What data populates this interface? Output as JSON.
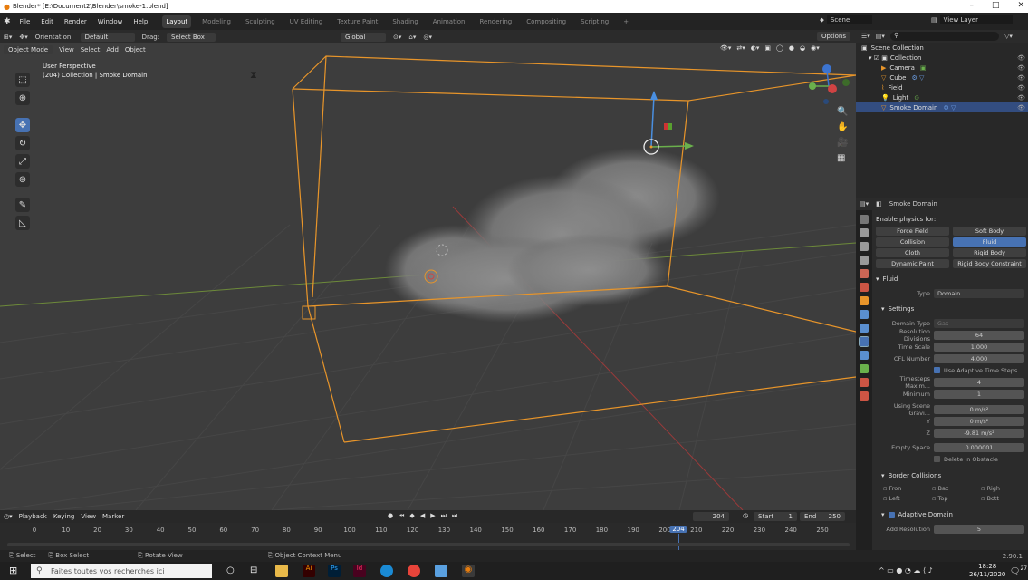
{
  "window": {
    "title": "Blender* [E:\\Document2\\Blender\\smoke-1.blend]"
  },
  "menu": {
    "items": [
      "File",
      "Edit",
      "Render",
      "Window",
      "Help"
    ],
    "workspaces": [
      "Layout",
      "Modeling",
      "Sculpting",
      "UV Editing",
      "Texture Paint",
      "Shading",
      "Animation",
      "Rendering",
      "Compositing",
      "Scripting",
      "+"
    ],
    "scene": "Scene",
    "view_layer": "View Layer"
  },
  "header": {
    "orientation_label": "Orientation:",
    "orientation_value": "Default",
    "drag_label": "Drag:",
    "drag_value": "Select Box",
    "transform": "Global",
    "options": "Options"
  },
  "viewport": {
    "mode": "Object Mode",
    "menu": [
      "View",
      "Select",
      "Add",
      "Object"
    ],
    "perspective": "User Perspective",
    "collection_info": "(204) Collection | Smoke Domain"
  },
  "timeline": {
    "menu": [
      "Playback",
      "Keying",
      "View",
      "Marker"
    ],
    "current_frame": "204",
    "start_label": "Start",
    "start": "1",
    "end_label": "End",
    "end": "250",
    "ticks": [
      "0",
      "10",
      "20",
      "30",
      "40",
      "50",
      "60",
      "70",
      "80",
      "90",
      "100",
      "110",
      "120",
      "130",
      "140",
      "150",
      "160",
      "170",
      "180",
      "190",
      "200",
      "210",
      "220",
      "230",
      "240",
      "250"
    ]
  },
  "statusbar": {
    "select": "Select",
    "box_select": "Box Select",
    "rotate": "Rotate View",
    "context": "Object Context Menu",
    "version": "2.90.1"
  },
  "taskbar": {
    "search_placeholder": "Faites toutes vos recherches ici",
    "time": "18:28",
    "date": "26/11/2020",
    "notif": "27"
  },
  "outliner": {
    "root": "Scene Collection",
    "collection": "Collection",
    "items": [
      "Camera",
      "Cube",
      "Field",
      "Light",
      "Smoke Domain"
    ]
  },
  "properties": {
    "object_name": "Smoke Domain",
    "enable_physics": "Enable physics for:",
    "physics_buttons": [
      "Force Field",
      "Soft Body",
      "Collision",
      "Fluid",
      "Cloth",
      "Rigid Body",
      "Dynamic Paint",
      "Rigid Body Constraint"
    ],
    "fluid_panel": "Fluid",
    "type_label": "Type",
    "type_value": "Domain",
    "settings_panel": "Settings",
    "fields": [
      {
        "label": "Domain Type",
        "value": "Gas"
      },
      {
        "label": "Resolution Divisions",
        "value": "64"
      },
      {
        "label": "Time Scale",
        "value": "1.000"
      },
      {
        "label": "CFL Number",
        "value": "4.000"
      }
    ],
    "adaptive_steps": "Use Adaptive Time Steps",
    "timesteps_max_label": "Timesteps Maxim...",
    "timesteps_max": "4",
    "minimum_label": "Minimum",
    "minimum": "1",
    "gravity_label": "Using Scene Gravi...",
    "gravity": [
      "0 m/s²",
      "0 m/s²",
      "-9.81 m/s²"
    ],
    "y_label": "Y",
    "z_label": "Z",
    "empty_space_label": "Empty Space",
    "empty_space": "0.000001",
    "delete_obstacle": "Delete in Obstacle",
    "border_panel": "Border Collisions",
    "borders": [
      "Fron",
      "Bac",
      "Righ",
      "Left",
      "Top",
      "Bott"
    ],
    "adaptive_domain": "Adaptive Domain",
    "add_resolution_label": "Add Resolution",
    "add_resolution": "5"
  }
}
